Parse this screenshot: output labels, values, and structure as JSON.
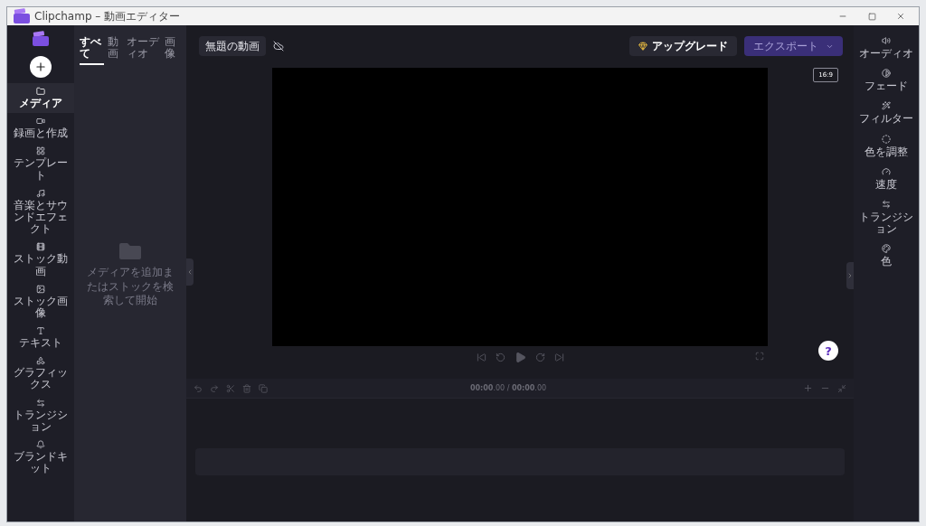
{
  "window": {
    "title": "Clipchamp – 動画エディター"
  },
  "nav": {
    "items": [
      {
        "label": "メディア",
        "selected": true
      },
      {
        "label": "録画と作成",
        "selected": false
      },
      {
        "label": "テンプレート",
        "selected": false
      },
      {
        "label": "音楽とサウンドエフェクト",
        "selected": false
      },
      {
        "label": "ストック動画",
        "selected": false
      },
      {
        "label": "ストック画像",
        "selected": false
      },
      {
        "label": "テキスト",
        "selected": false
      },
      {
        "label": "グラフィックス",
        "selected": false
      },
      {
        "label": "トランジション",
        "selected": false
      },
      {
        "label": "ブランドキット",
        "selected": false
      }
    ]
  },
  "media_panel": {
    "tabs": [
      {
        "label": "すべて",
        "selected": true
      },
      {
        "label": "動画",
        "selected": false
      },
      {
        "label": "オーディオ",
        "selected": false
      },
      {
        "label": "画像",
        "selected": false
      }
    ],
    "empty_message": "メディアを追加またはストックを検索して開始"
  },
  "toolbar": {
    "project_name": "無題の動画",
    "upgrade": "アップグレード",
    "export": {
      "label": "エクスポート",
      "disabled": true
    }
  },
  "preview": {
    "aspect_ratio": "16:9"
  },
  "help": "?",
  "timeline": {
    "time": "**00:00**.00 / **00:00**.00"
  },
  "properties": {
    "items": [
      "オーディオ",
      "フェード",
      "フィルター",
      "色を調整",
      "速度",
      "トランジション",
      "色"
    ]
  }
}
